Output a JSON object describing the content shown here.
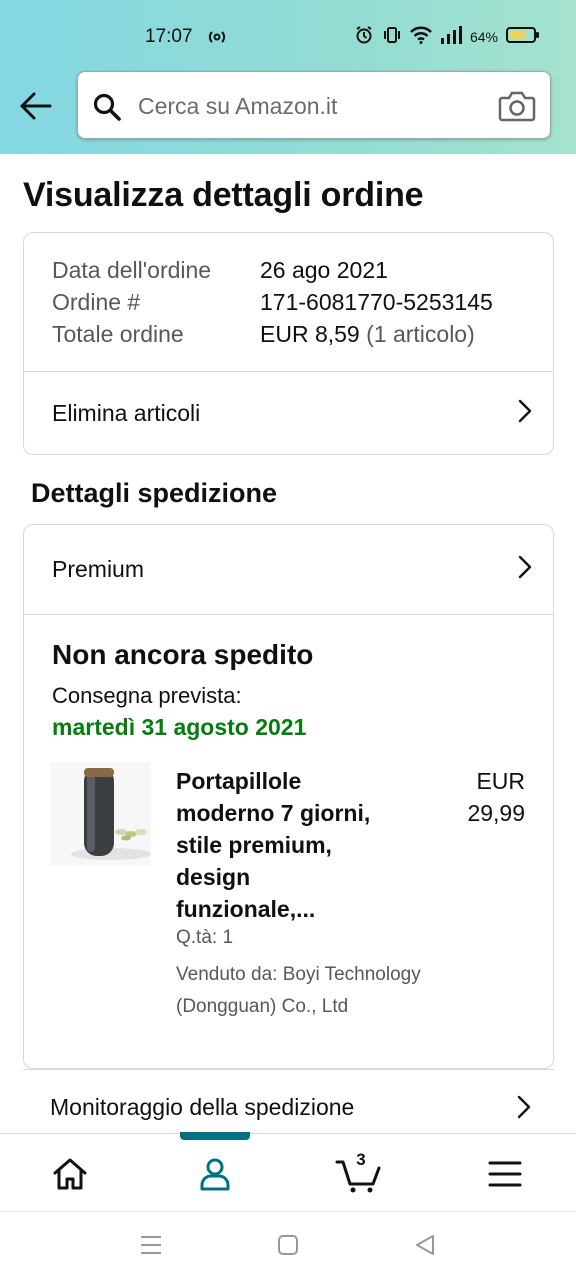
{
  "status_bar": {
    "time": "17:07",
    "battery": "64%"
  },
  "search": {
    "placeholder": "Cerca su Amazon.it"
  },
  "page": {
    "title": "Visualizza dettagli ordine"
  },
  "order": {
    "rows": [
      {
        "label": "Data dell'ordine",
        "value": "26 ago 2021"
      },
      {
        "label": "Ordine #",
        "value": "171-6081770-5253145"
      },
      {
        "label": "Totale ordine",
        "value": "EUR 8,59",
        "extra": "(1 articolo)"
      }
    ],
    "delete_items_label": "Elimina articoli"
  },
  "shipping": {
    "section_title": "Dettagli spedizione",
    "method": "Premium",
    "status": "Non ancora spedito",
    "delivery_label": "Consegna prevista:",
    "delivery_date": "martedì 31 agosto 2021",
    "delivery_date_color": "#067d10",
    "item": {
      "title_lines": [
        "Portapillole",
        "moderno 7 giorni,",
        "stile premium,",
        "design",
        "funzionale,..."
      ],
      "price_currency": "EUR",
      "price_value": "29,99",
      "quantity": "Q.tà: 1",
      "seller_lines": [
        "Venduto da: Boyi Technology",
        "(Dongguan) Co., Ltd"
      ]
    },
    "tracking_label": "Monitoraggio della spedizione"
  },
  "bottom_nav": {
    "items": [
      "home-icon",
      "account-icon",
      "cart-icon",
      "menu-icon"
    ],
    "active": "account-icon",
    "cart_count": "3",
    "accent_color": "#007185"
  },
  "system_nav": [
    "recents-icon",
    "home-square-icon",
    "back-triangle-icon"
  ]
}
